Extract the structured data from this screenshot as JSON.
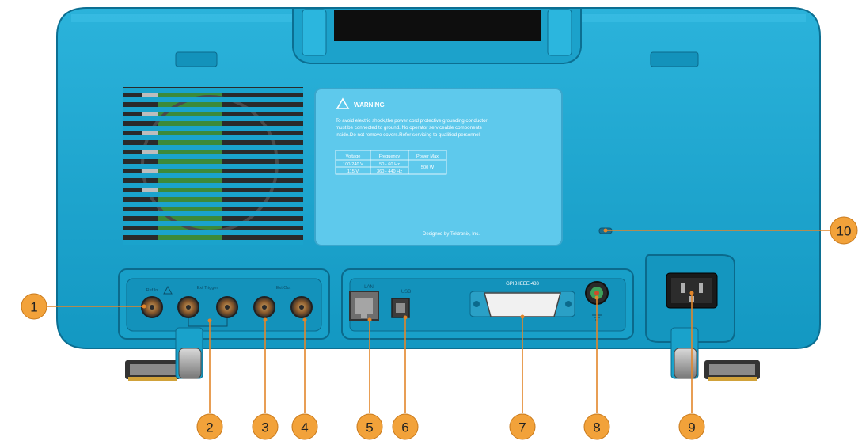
{
  "colors": {
    "body": "#19a6cf",
    "body_dark": "#0e7ea3",
    "body_light": "#4cc3e6",
    "callout": "#f2a23a",
    "callout_line": "#e2862a",
    "label_plate": "#5cc9ec"
  },
  "warning_label": {
    "heading": "WARNING",
    "text_line_1": "To avoid electric shock,the power cord protective grounding conductor",
    "text_line_2": "must be connected to ground. No operator serviceable components",
    "text_line_3": "inside.Do not remove covers.Refer servicing to qualified personnel.",
    "table_headers": [
      "Voltage",
      "Frequency",
      "Power Max"
    ],
    "table_rows": [
      [
        "100-240 V",
        "50 - 60 Hz"
      ],
      [
        "115 V",
        "360 - 440 Hz"
      ]
    ],
    "power_value": "500 W",
    "designed_by": "Designed by Tektronix, Inc."
  },
  "panel_labels": {
    "ref_in": "Ref In",
    "ext_trigger": "Ext Trigger",
    "ext_out": "Ext Out",
    "lan": "LAN",
    "usb": "USB",
    "gpib": "GPIB IEEE-488"
  },
  "callouts": [
    "1",
    "2",
    "3",
    "4",
    "5",
    "6",
    "7",
    "8",
    "9",
    "10"
  ]
}
